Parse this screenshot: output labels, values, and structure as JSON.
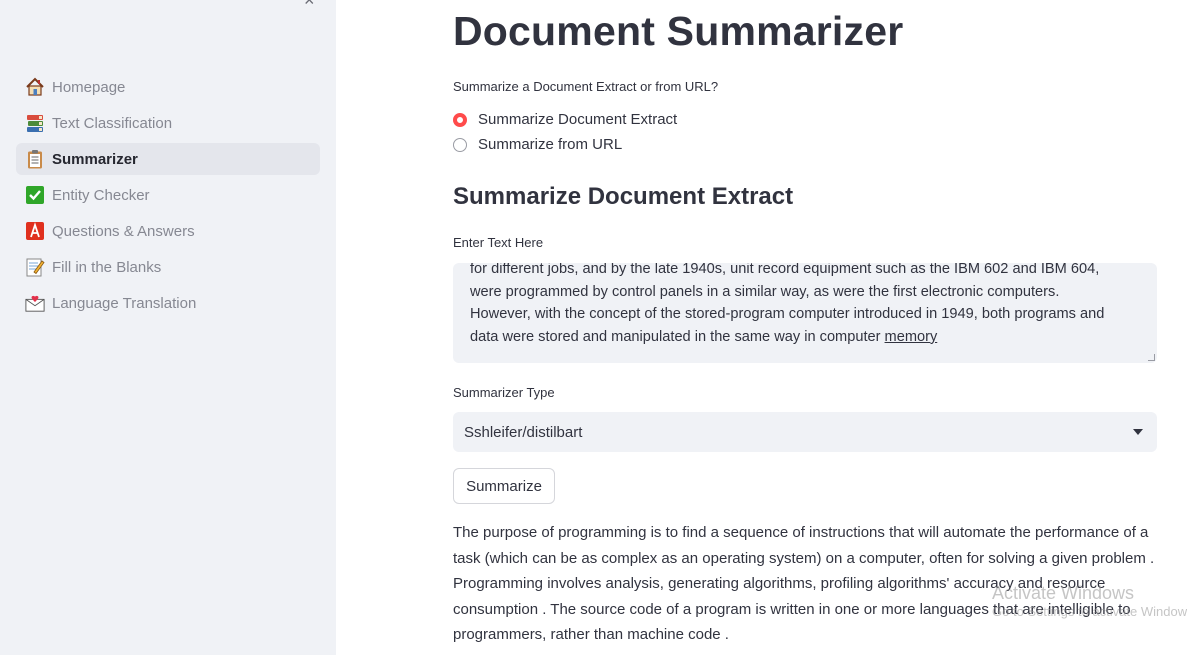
{
  "sidebar": {
    "close_icon": "×",
    "items": [
      {
        "label": "Homepage",
        "icon": "house-icon",
        "active": false
      },
      {
        "label": "Text Classification",
        "icon": "books-icon",
        "active": false
      },
      {
        "label": "Summarizer",
        "icon": "clipboard-icon",
        "active": true
      },
      {
        "label": "Entity Checker",
        "icon": "check-mark-icon",
        "active": false
      },
      {
        "label": "Questions & Answers",
        "icon": "a-button-icon",
        "active": false
      },
      {
        "label": "Fill in the Blanks",
        "icon": "memo-icon",
        "active": false
      },
      {
        "label": "Language Translation",
        "icon": "envelope-heart-icon",
        "active": false
      }
    ]
  },
  "main": {
    "title": "Document Summarizer",
    "mode_question": "Summarize a Document Extract or from URL?",
    "mode_options": [
      {
        "label": "Summarize Document Extract",
        "checked": true
      },
      {
        "label": "Summarize from URL",
        "checked": false
      }
    ],
    "section_title": "Summarize Document Extract",
    "text_label": "Enter Text Here",
    "text_value_lines": [
      "for different jobs, and by the late 1940s, unit record equipment such as the IBM 602 and IBM 604,",
      "were programmed by control panels in a similar way, as were the first electronic computers.",
      "However, with the concept of the stored-program computer introduced in 1949, both programs and",
      "data were stored and manipulated in the same way in computer "
    ],
    "text_value_link": "memory",
    "summarizer_label": "Summarizer Type",
    "summarizer_value": "Sshleifer/distilbart",
    "summarize_button": "Summarize",
    "output_text": "The purpose of programming is to find a sequence of instructions that will automate the performance of a task (which can be as complex as an operating system) on a computer, often for solving a given problem . Programming involves analysis, generating algorithms, profiling algorithms' accuracy and resource consumption . The source code of a program is written in one or more languages that are intelligible to programmers, rather than machine code ."
  },
  "watermark": {
    "line1": "Activate Windows",
    "line2": "Go to Settings to activate Windows."
  },
  "colors": {
    "sidebar_bg": "#f0f2f6",
    "accent_radio": "#ff4b4b",
    "text": "#31333f",
    "muted_nav": "#868892"
  }
}
